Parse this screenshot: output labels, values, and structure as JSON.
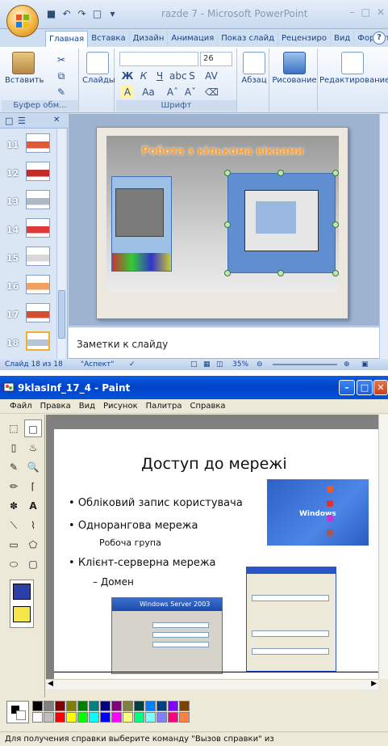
{
  "powerpoint": {
    "window_title": "razde 7 - Microsoft PowerPoint",
    "tabs": [
      "Главная",
      "Вставка",
      "Дизайн",
      "Анимация",
      "Показ слайд",
      "Рецензиро",
      "Вид",
      "Формат"
    ],
    "active_tab": 0,
    "ribbon": {
      "paste_label": "Вставить",
      "slides_label": "Слайды",
      "clipboard_group": "Буфер обм...",
      "font_group": "Шрифт",
      "font_size": "26",
      "paragraph_label": "Абзац",
      "drawing_label": "Рисование",
      "editing_label": "Редактирование"
    },
    "thumbnails": [
      {
        "num": "11"
      },
      {
        "num": "12"
      },
      {
        "num": "13"
      },
      {
        "num": "14"
      },
      {
        "num": "15"
      },
      {
        "num": "16"
      },
      {
        "num": "17"
      },
      {
        "num": "18",
        "selected": true
      }
    ],
    "slide_title": "Робота з кількома вікнами",
    "notes_placeholder": "Заметки к слайду",
    "status": {
      "slide_counter": "Слайд 18 из 18",
      "theme": "\"Аспект\"",
      "zoom": "35%"
    }
  },
  "paint": {
    "window_title": "9klasInf_17_4 - Paint",
    "menu": [
      "Файл",
      "Правка",
      "Вид",
      "Рисунок",
      "Палитра",
      "Справка"
    ],
    "canvas_content": {
      "title": "Доступ до мережі",
      "bullets": [
        "Обліковий запис користувача",
        "Однорангова мережа",
        "Клієнт-серверна  мережа"
      ],
      "sub_items": [
        "Робоча група",
        "– Домен"
      ],
      "windows_brand": "Windows",
      "server_brand": "Windows Server 2003"
    },
    "status_text": "Для получения справки выберите команду \"Вызов справки\" из"
  }
}
